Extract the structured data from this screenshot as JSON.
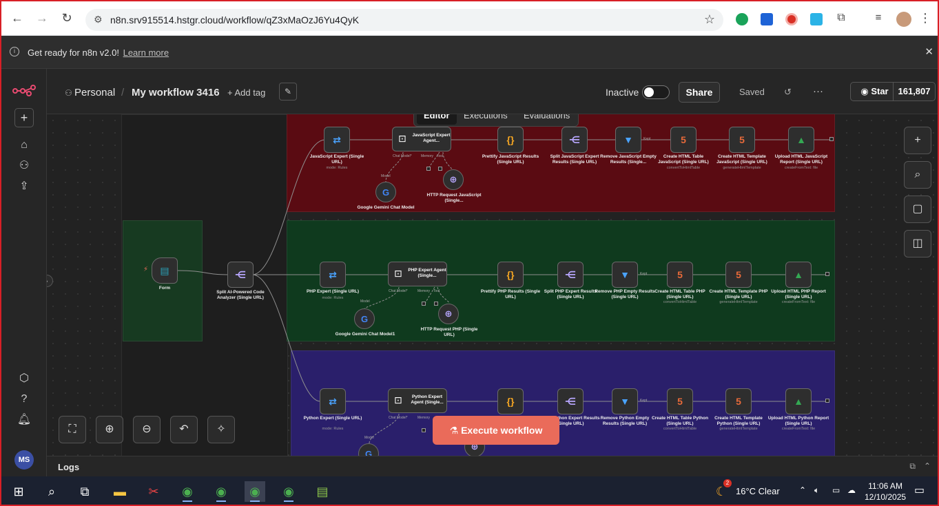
{
  "browser": {
    "url": "n8n.srv915514.hstgr.cloud/workflow/qZ3xMaOzJ6Yu4QyK",
    "back_icon": "arrow-left-icon",
    "forward_icon": "arrow-right-icon",
    "reload_icon": "reload-icon"
  },
  "banner": {
    "text": "Get ready for n8n v2.0!",
    "link": "Learn more"
  },
  "header": {
    "project": "Personal",
    "workflow_name": "My workflow 3416",
    "add_tag": "+ Add tag",
    "status_label": "Inactive",
    "share": "Share",
    "saved": "Saved",
    "star": "Star",
    "star_count": "161,807"
  },
  "tabs": [
    "Editor",
    "Executions",
    "Evaluations"
  ],
  "nodes": {
    "form": "Form",
    "split": "Split AI-Powered Code Analyzer (Single URL)",
    "js": {
      "expert": "JavaScript Expert (Single URL)",
      "expert_sub": "mode: Rules",
      "agent": "JavaScript Expert Agent...",
      "model": "Google Gemini Chat Model",
      "http": "HTTP Request JavaScript (Single...",
      "prettify": "Prettify JavaScript Results (Single URL)",
      "split": "Split JavaScript Expert Results (Single URL)",
      "remove": "Remove JavaScript Empty Results (Single...",
      "table": "Create HTML Table JavaScript (Single URL)",
      "table_sub": "convertToHtmlTable",
      "template": "Create HTML Template JavaScript (Single URL)",
      "template_sub": "generateHtmlTemplate",
      "upload": "Upload HTML JavaScript Report (Single URL)",
      "upload_sub": "createFromText: file"
    },
    "php": {
      "expert": "PHP Expert (Single URL)",
      "expert_sub": "mode: Rules",
      "agent": "PHP Expert Agent (Single...",
      "model": "Google Gemini Chat Model1",
      "http": "HTTP Request PHP (Single URL)",
      "prettify": "Prettify PHP Results (Single URL)",
      "split": "Split PHP Expert Results (Single URL)",
      "remove": "Remove PHP Empty Results (Single URL)",
      "table": "Create HTML Table PHP (Single URL)",
      "table_sub": "convertToHtmlTable",
      "template": "Create HTML Template PHP (Single URL)",
      "template_sub": "generateHtmlTemplate",
      "upload": "Upload HTML PHP Report (Single URL)",
      "upload_sub": "createFromText: file"
    },
    "python": {
      "expert": "Python Expert (Single URL)",
      "expert_sub": "mode: Rules",
      "agent": "Python Expert Agent (Single...",
      "split": "Split Python Expert Results (Single URL)",
      "remove": "Remove Python Empty Results (Single URL)",
      "table": "Create HTML Table Python (Single URL)",
      "table_sub": "convertToHtmlTable",
      "template": "Create HTML Template Python (Single URL)",
      "template_sub": "generateHtmlTemplate",
      "upload": "Upload HTML Python Report (Single URL)",
      "upload_sub": "createFromText: file"
    },
    "port_labels": {
      "chat_model": "Chat Model*",
      "memory": "Memory",
      "tool": "Tool",
      "model": "Model",
      "kept": "Kept"
    }
  },
  "execute": "Execute workflow",
  "logs": "Logs",
  "avatar": "MS",
  "taskbar": {
    "weather": "16°C  Clear",
    "time": "11:06 AM",
    "date": "12/10/2025",
    "badge": "2"
  },
  "colors": {
    "js_region": "#5a0b12",
    "php_region": "#0f3a1e",
    "py_region": "#2a1f6b",
    "accent": "#ea6b5a",
    "brand": "#ea4b71"
  }
}
